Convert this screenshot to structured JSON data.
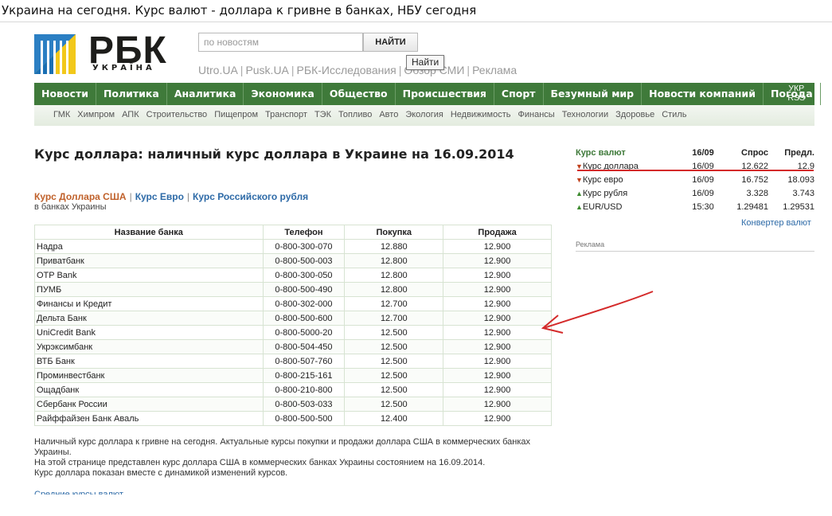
{
  "window": {
    "title": "Украина на сегодня. Курс валют - доллара к гривне в банках, НБУ сегодня"
  },
  "logo": {
    "text": "РБК",
    "subtitle": "УКРАЇНА"
  },
  "search": {
    "placeholder": "по новостям",
    "button_label": "НАЙТИ",
    "tooltip": "Найти"
  },
  "toplinks": [
    "Utro.UA",
    "Pusk.UA",
    "РБК-Исследования",
    "Обзор СМИ",
    "Реклама"
  ],
  "nav": {
    "items": [
      "Новости",
      "Политика",
      "Аналитика",
      "Экономика",
      "Общество",
      "Происшествия",
      "Спорт",
      "Безумный мир",
      "Новости компаний",
      "Погода"
    ],
    "lang": "УКР",
    "rss": "RSS"
  },
  "subnav": [
    "ГМК",
    "Химпром",
    "АПК",
    "Строительство",
    "Пищепром",
    "Транспорт",
    "ТЭК",
    "Топливо",
    "Авто",
    "Экология",
    "Недвижимость",
    "Финансы",
    "Технологии",
    "Здоровье",
    "Стиль"
  ],
  "page": {
    "title": "Курс доллара: наличный курс доллара в Украине на 16.09.2014",
    "tabs": {
      "active": "Курс Доллара США",
      "euro": "Курс Евро",
      "rub": "Курс Российского рубля"
    },
    "in_banks": "в банках Украины"
  },
  "bank_table": {
    "headers": [
      "Название банка",
      "Телефон",
      "Покупка",
      "Продажа"
    ],
    "rows": [
      [
        "Надра",
        "0-800-300-070",
        "12.880",
        "12.900"
      ],
      [
        "Приватбанк",
        "0-800-500-003",
        "12.800",
        "12.900"
      ],
      [
        "OTP Bank",
        "0-800-300-050",
        "12.800",
        "12.900"
      ],
      [
        "ПУМБ",
        "0-800-500-490",
        "12.800",
        "12.900"
      ],
      [
        "Финансы и Кредит",
        "0-800-302-000",
        "12.700",
        "12.900"
      ],
      [
        "Дельта Банк",
        "0-800-500-600",
        "12.700",
        "12.900"
      ],
      [
        "UniCredit Bank",
        "0-800-5000-20",
        "12.500",
        "12.900"
      ],
      [
        "Укрэксимбанк",
        "0-800-504-450",
        "12.500",
        "12.900"
      ],
      [
        "ВТБ Банк",
        "0-800-507-760",
        "12.500",
        "12.900"
      ],
      [
        "Проминвестбанк",
        "0-800-215-161",
        "12.500",
        "12.900"
      ],
      [
        "Ощадбанк",
        "0-800-210-800",
        "12.500",
        "12.900"
      ],
      [
        "Сбербанк России",
        "0-800-503-033",
        "12.500",
        "12.900"
      ],
      [
        "Райффайзен Банк Аваль",
        "0-800-500-500",
        "12.400",
        "12.900"
      ]
    ]
  },
  "description": {
    "line1": "Наличный курс доллара к гривне на сегодня. Актуальные курсы покупки и продажи доллара США в коммерческих банках Украины.",
    "line2": "На этой странице представлен курс доллара США в коммерческих банках Украины состоянием на 16.09.2014.",
    "line3": "Курс доллара показан вместе с динамикой изменений курсов.",
    "cut_link": "Средние курсы валют"
  },
  "rates": {
    "headers": [
      "Курс валют",
      "16/09",
      "Спрос",
      "Предл."
    ],
    "rows": [
      {
        "dir": "down",
        "name": "Курс доллара",
        "date": "16/09",
        "bid": "12.622",
        "ask": "12.9"
      },
      {
        "dir": "down",
        "name": "Курс евро",
        "date": "16/09",
        "bid": "16.752",
        "ask": "18.093"
      },
      {
        "dir": "up",
        "name": "Курс рубля",
        "date": "16/09",
        "bid": "3.328",
        "ask": "3.743"
      },
      {
        "dir": "up",
        "name": "EUR/USD",
        "date": "15:30",
        "bid": "1.29481",
        "ask": "1.29531"
      }
    ],
    "converter": "Конвертер валют",
    "ad_label": "Реклама"
  },
  "colors": {
    "nav_green": "#3f7a3a",
    "link_blue": "#2d6aa7",
    "active_orange": "#c0612b",
    "annotation_red": "#d42a2a"
  }
}
